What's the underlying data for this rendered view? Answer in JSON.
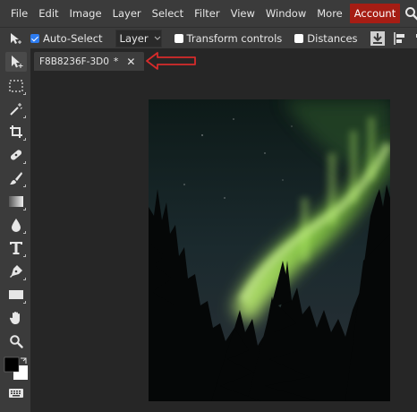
{
  "menu": {
    "items": [
      "File",
      "Edit",
      "Image",
      "Layer",
      "Select",
      "Filter",
      "View",
      "Window",
      "More"
    ],
    "account_label": "Account"
  },
  "options_bar": {
    "auto_select_label": "Auto-Select",
    "auto_select_checked": true,
    "layer_select_value": "Layer",
    "transform_controls_label": "Transform controls",
    "transform_controls_checked": false,
    "distances_label": "Distances",
    "distances_checked": false
  },
  "tools": [
    {
      "icon": "move-tool-icon",
      "active": true
    },
    {
      "icon": "marquee-select-icon"
    },
    {
      "icon": "magic-wand-icon"
    },
    {
      "icon": "crop-icon"
    },
    {
      "icon": "healing-bandage-icon"
    },
    {
      "icon": "brush-icon"
    },
    {
      "icon": "gradient-icon"
    },
    {
      "icon": "paint-drop-icon"
    },
    {
      "icon": "type-tool-icon"
    },
    {
      "icon": "pen-tool-icon"
    },
    {
      "icon": "rectangle-shape-icon"
    },
    {
      "icon": "hand-tool-icon"
    },
    {
      "icon": "zoom-icon"
    },
    {
      "icon": "color-swatches-icon"
    },
    {
      "icon": "keyboard-icon"
    }
  ],
  "document_tab": {
    "name": "F8B8236F-3D0",
    "modified_marker": "*",
    "close_label": "✕"
  },
  "colors": {
    "account_accent": "#a61d14",
    "checkbox_accent": "#2d7cf0",
    "annotation_arrow": "#d62b2b",
    "aurora_green": "#9ae24a"
  }
}
